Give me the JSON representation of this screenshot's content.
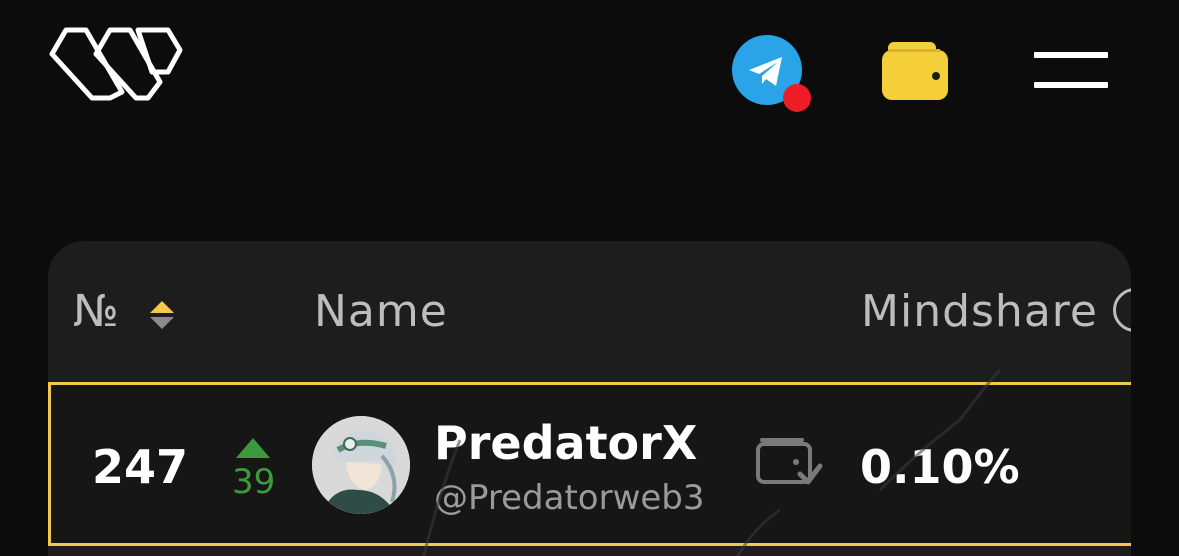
{
  "header": {
    "logo_icon": "w-logo-icon",
    "telegram_icon": "telegram-icon",
    "notification_color": "#ee1c24",
    "wallet_icon": "wallet-icon",
    "menu_icon": "hamburger-menu-icon"
  },
  "table": {
    "columns": {
      "rank": "№",
      "name": "Name",
      "mindshare": "Mindshare"
    },
    "row": {
      "rank": "247",
      "change": "39",
      "change_direction": "up",
      "display_name": "PredatorX",
      "handle": "@Predatorweb3",
      "mindshare": "0.10%"
    }
  },
  "colors": {
    "accent": "#f2c94c",
    "positive": "#3c9a3c",
    "telegram": "#2aa3e8"
  }
}
